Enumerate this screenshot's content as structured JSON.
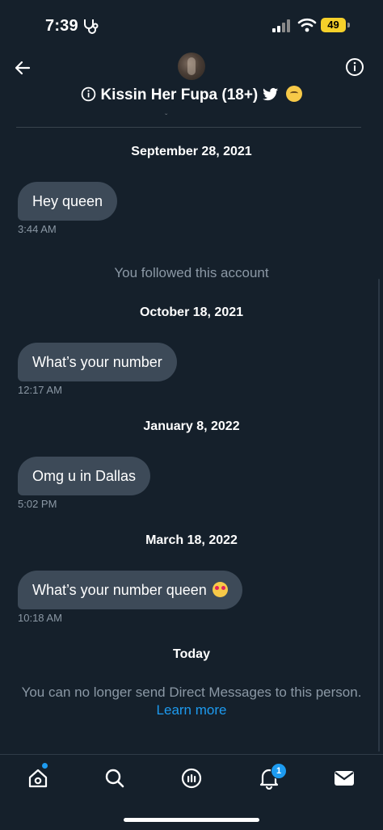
{
  "status_bar": {
    "time": "7:39",
    "battery": "49"
  },
  "header": {
    "title": "Kissin Her Fupa (18+)",
    "back_icon": "arrow-left-icon",
    "info_icon": "info-icon"
  },
  "conversation": {
    "dates": [
      "September 28, 2021",
      "October 18, 2021",
      "January 8, 2022",
      "March 18, 2022",
      "Today"
    ],
    "messages": [
      {
        "text": "Hey queen",
        "time": "3:44 AM"
      },
      {
        "text": "What’s your number",
        "time": "12:17 AM"
      },
      {
        "text": "Omg u in Dallas",
        "time": "5:02 PM"
      },
      {
        "text": "What’s your number queen",
        "time": "10:18 AM"
      }
    ],
    "followed_note": "You followed this account",
    "blocked_note": "You can no longer send Direct Messages to this person.",
    "learn_more": "Learn more"
  },
  "bottom_nav": {
    "items": [
      {
        "icon": "home-icon"
      },
      {
        "icon": "search-icon"
      },
      {
        "icon": "spaces-icon"
      },
      {
        "icon": "bell-icon"
      },
      {
        "icon": "mail-icon"
      }
    ],
    "notification_count": "1"
  },
  "colors": {
    "background": "#15202b",
    "bubble": "#3d4a58",
    "accent": "#1d9bf0",
    "muted": "#8b98a5"
  }
}
